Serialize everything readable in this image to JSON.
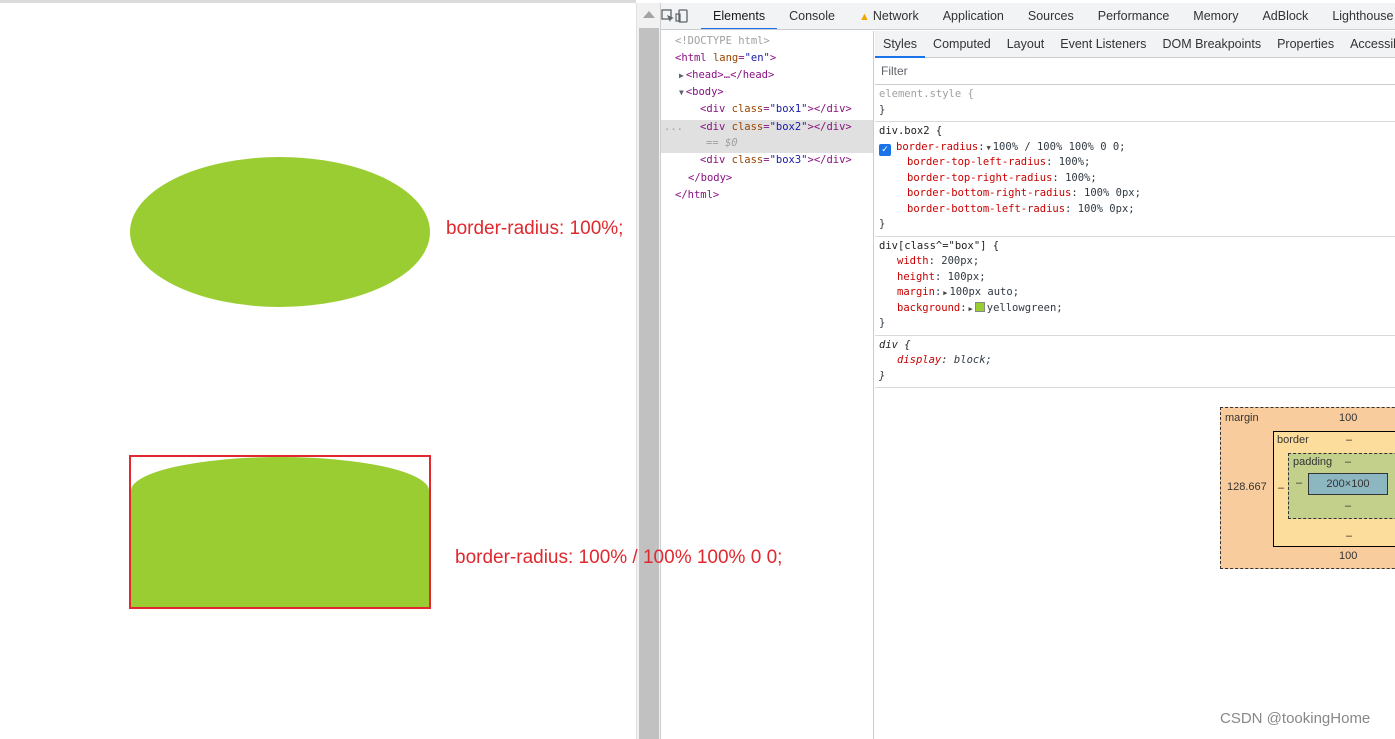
{
  "page": {
    "caption1": "border-radius: 100%;",
    "caption2": "border-radius: 100% / 100% 100% 0 0;"
  },
  "devtools": {
    "tabs": [
      "Elements",
      "Console",
      "Network",
      "Application",
      "Sources",
      "Performance",
      "Memory",
      "AdBlock",
      "Lighthouse"
    ],
    "active_tab": "Elements",
    "dom": {
      "doctype": "<!DOCTYPE html>",
      "html_open": "html",
      "lang_attr": "lang",
      "lang_val": "\"en\"",
      "head": "<head>…</head>",
      "body_open": "<body>",
      "div": "div",
      "class_attr": "class",
      "box1": "\"box1\"",
      "box2": "\"box2\"",
      "box3": "\"box3\"",
      "div_close": "></div>",
      "selected_marker": "== $0",
      "body_close": "</body>",
      "html_close": "</html>",
      "ellipsis": "..."
    },
    "sub_tabs": [
      "Styles",
      "Computed",
      "Layout",
      "Event Listeners",
      "DOM Breakpoints",
      "Properties",
      "Accessibility"
    ],
    "filter_placeholder": "Filter",
    "rules": {
      "element_style": "element.style {",
      "close": "}",
      "box2_selector": "div.box2 {",
      "br_prop": "border-radius",
      "br_val": "100% / 100% 100% 0 0;",
      "tl_prop": "border-top-left-radius",
      "tl_val": "100%;",
      "tr_prop": "border-top-right-radius",
      "tr_val": "100%;",
      "brr_prop": "border-bottom-right-radius",
      "brr_val": "100% 0px;",
      "bl_prop": "border-bottom-left-radius",
      "bl_val": "100% 0px;",
      "box_selector": "div[class^=\"box\"] {",
      "width_prop": "width",
      "width_val": "200px;",
      "height_prop": "height",
      "height_val": "100px;",
      "margin_prop": "margin",
      "margin_val": "100px auto;",
      "bg_prop": "background",
      "bg_val": "yellowgreen;",
      "div_selector": "div {",
      "display_prop": "display",
      "display_val": "block;"
    },
    "box_model": {
      "margin_label": "margin",
      "margin_top": "100",
      "margin_left": "128.667",
      "margin_bottom": "100",
      "border_label": "border",
      "border_top": "–",
      "border_bottom": "–",
      "border_left": "–",
      "padding_label": "padding",
      "padding_top": "–",
      "padding_left": "–",
      "padding_bottom": "–",
      "content": "200×100"
    },
    "colors": {
      "accent": "#1a73e8",
      "shape": "#9acd32",
      "caption": "#e0282e"
    }
  },
  "watermark": "CSDN @tookingHome"
}
